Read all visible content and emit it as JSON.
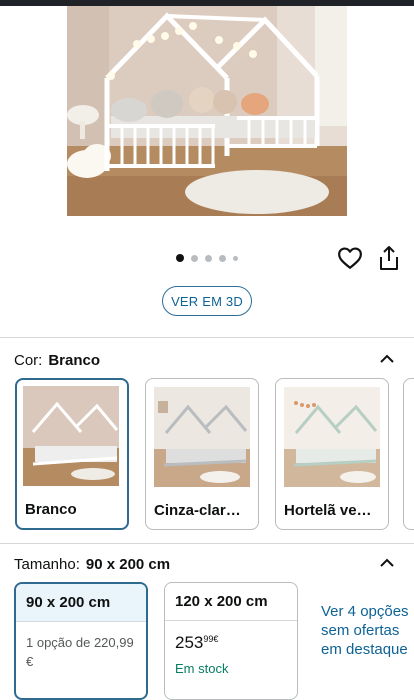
{
  "gallery": {
    "image_alt": "Cama casa infantil branca",
    "dots": 5,
    "active_dot": 1
  },
  "actions": {
    "wishlist_icon": "heart-icon",
    "share_icon": "share-icon",
    "view_3d_label": "VER EM 3D"
  },
  "color": {
    "label": "Cor:",
    "selected": "Branco",
    "options": [
      {
        "name": "Branco",
        "frame": "#ffffff"
      },
      {
        "name": "Cinza-clar…",
        "frame": "#b9bdbf"
      },
      {
        "name": "Hortelã ve…",
        "frame": "#b7cfc3"
      }
    ]
  },
  "size": {
    "label": "Tamanho:",
    "selected": "90 x 200 cm",
    "options": [
      {
        "name": "90 x 200 cm",
        "offer": "1 opção de 220,99 €"
      },
      {
        "name": "120 x 200 cm",
        "price_whole": "253",
        "price_fraction": "99",
        "currency": "€",
        "stock": "Em stock"
      }
    ],
    "more_offers": "Ver 4 opções sem ofertas em destaque"
  },
  "colors": {
    "link": "#0e6395",
    "selected_border": "#2f6a91",
    "in_stock": "#067d62"
  }
}
